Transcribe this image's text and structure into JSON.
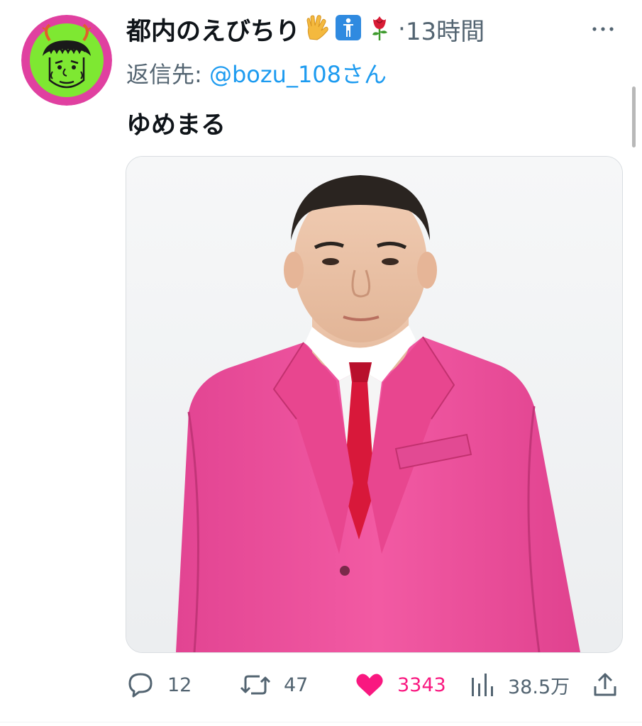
{
  "tweet": {
    "display_name": "都内のえびちり",
    "name_emojis": [
      "vulcan-salute-emoji",
      "person-standing-emoji",
      "rose-emoji"
    ],
    "separator": "·",
    "timestamp": "13時間",
    "more_icon": "more-horizontal-icon",
    "reply_label": "返信先: ",
    "reply_handle": "@bozu_108さん",
    "text": "ゆめまる",
    "media_description": "photo of man in pink suit with red tie"
  },
  "actions": {
    "reply": {
      "icon": "reply-icon",
      "count": "12"
    },
    "retweet": {
      "icon": "retweet-icon",
      "count": "47"
    },
    "like": {
      "icon": "heart-icon",
      "count": "3343",
      "active": true
    },
    "views": {
      "icon": "analytics-icon",
      "count": "38.5万"
    },
    "share": {
      "icon": "share-icon"
    }
  },
  "colors": {
    "text_primary": "#0f1419",
    "text_secondary": "#536471",
    "link": "#1d9bf0",
    "like_active": "#f91880",
    "avatar_ring": "#e040a0",
    "avatar_face": "#7ee832",
    "suit_pink": "#ee4f9a",
    "tie_red": "#d8183a"
  }
}
